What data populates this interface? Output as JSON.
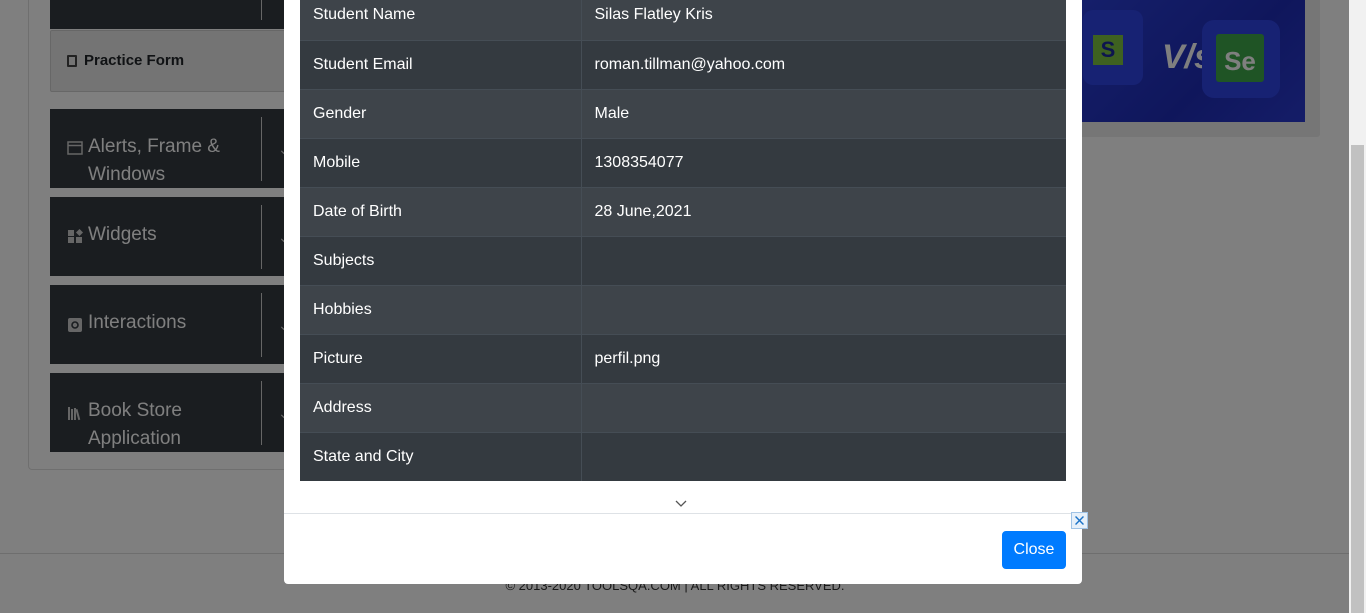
{
  "sidebar": {
    "practice_form_label": "Practice Form",
    "groups": [
      {
        "label_line1": "Alerts, Frame &",
        "label_line2": "Windows",
        "icon": "window-icon"
      },
      {
        "label": "Widgets",
        "icon": "widgets-icon"
      },
      {
        "label": "Interactions",
        "icon": "interactions-icon"
      },
      {
        "label_line1": "Book Store",
        "label_line2": "Application",
        "icon": "books-icon"
      }
    ]
  },
  "banner": {
    "left_logo_letter": "S",
    "vs_text": "V/s",
    "right_logo_text": "Se"
  },
  "footer": {
    "copyright": "© 2013-2020 TOOLSQA.COM | ALL RIGHTS RESERVED."
  },
  "modal": {
    "rows": [
      {
        "label": "Student Name",
        "value": "Silas Flatley Kris"
      },
      {
        "label": "Student Email",
        "value": "roman.tillman@yahoo.com"
      },
      {
        "label": "Gender",
        "value": "Male"
      },
      {
        "label": "Mobile",
        "value": "1308354077"
      },
      {
        "label": "Date of Birth",
        "value": "28 June,2021"
      },
      {
        "label": "Subjects",
        "value": ""
      },
      {
        "label": "Hobbies",
        "value": ""
      },
      {
        "label": "Picture",
        "value": "perfil.png"
      },
      {
        "label": "Address",
        "value": ""
      },
      {
        "label": "State and City",
        "value": ""
      }
    ],
    "close_label": "Close"
  },
  "colors": {
    "table_dark": "#343a40",
    "table_stripe": "#3e444a",
    "primary_button": "#007bff"
  }
}
